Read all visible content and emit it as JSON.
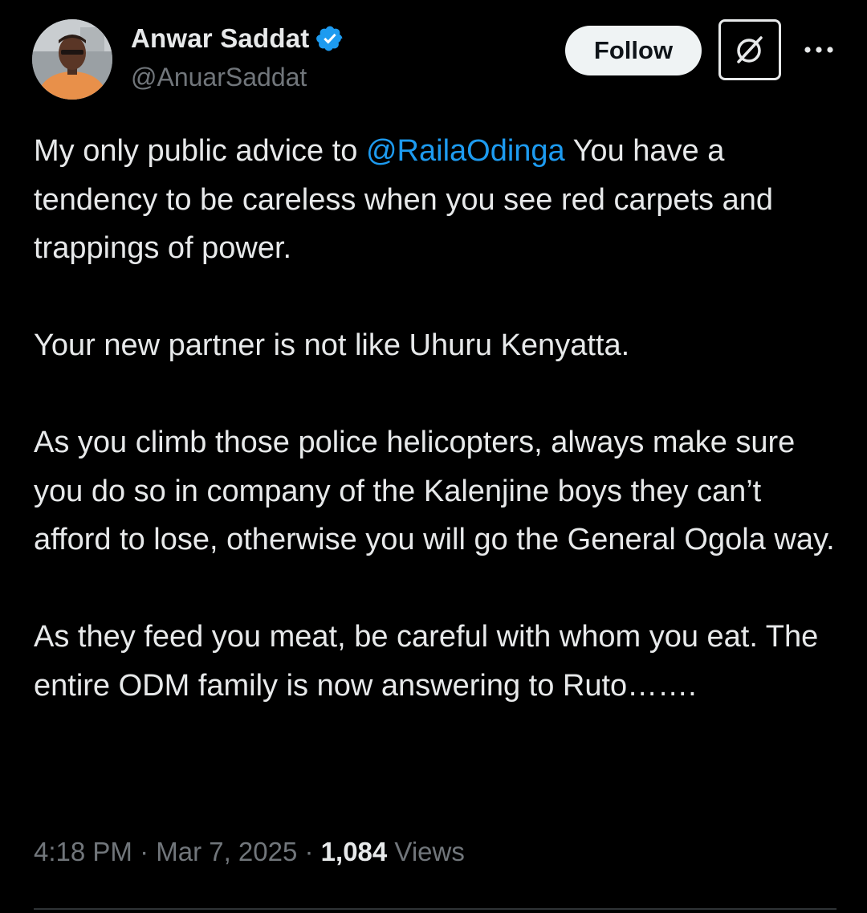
{
  "author": {
    "display_name": "Anwar Saddat",
    "handle": "@AnuarSaddat",
    "verified": true,
    "verified_color": "#1d9bf0"
  },
  "actions": {
    "follow_label": "Follow",
    "grok_icon": "grok-icon",
    "more_icon": "more-icon"
  },
  "tweet": {
    "paragraphs": [
      {
        "prefix": "My only public advice to ",
        "mention": "@RailaOdinga",
        "suffix": " You have a tendency to be careless when you see red carpets and trappings of power."
      },
      {
        "text": "Your new partner is not like Uhuru Kenyatta."
      },
      {
        "text": "As you climb those police helicopters, always make sure you do so in company of the Kalenjine boys they can’t afford to lose, otherwise you will go the General Ogola way."
      },
      {
        "text": "As they feed you meat, be careful with whom you eat. The entire ODM family is now answering to Ruto……."
      }
    ]
  },
  "meta": {
    "time": "4:18 PM",
    "separator": " · ",
    "date": "Mar 7, 2025",
    "views_count": "1,084",
    "views_label": " Views"
  },
  "colors": {
    "background": "#000000",
    "text": "#e7e9ea",
    "secondary": "#71767b",
    "link": "#1d9bf0"
  }
}
